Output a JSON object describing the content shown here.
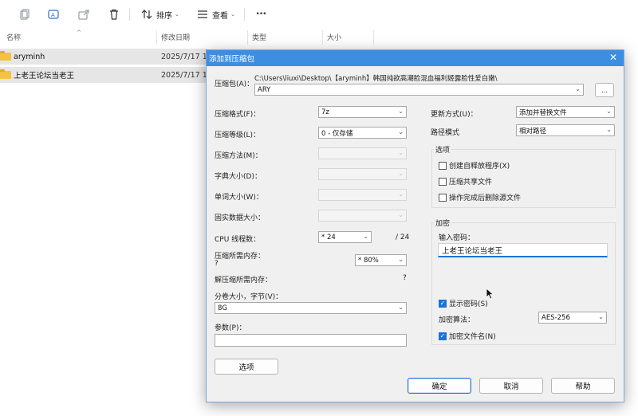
{
  "toolbar": {
    "sort_label": "排序",
    "view_label": "查看",
    "more_label": "•••"
  },
  "columns": {
    "name": "名称",
    "date": "修改日期",
    "type": "类型",
    "size": "大小"
  },
  "files": [
    {
      "name": "aryminh",
      "date": "2025/7/17 1"
    },
    {
      "name": "上老王论坛当老王",
      "date": "2025/7/17 1"
    }
  ],
  "dialog": {
    "title": "添加到压缩包",
    "close": "✕",
    "archive_label": "压缩包(A)：",
    "archive_path": "C:\\Users\\liuxi\\Desktop\\【aryminh】韩国纯欲高潮脸混血福利姬露脸性爱白嫩\\",
    "archive_name": "ARY",
    "browse": "...",
    "format_label": "压缩格式(F)：",
    "format_value": "7z",
    "level_label": "压缩等级(L)：",
    "level_value": "0 - 仅存储",
    "method_label": "压缩方法(M)：",
    "dict_label": "字典大小(D)：",
    "word_label": "单词大小(W)：",
    "solid_label": "固实数据大小：",
    "cpu_label": "CPU 线程数：",
    "cpu_value": "* 24",
    "cpu_total": "/ 24",
    "mem_comp_label": "压缩所需内存：",
    "mem_comp_q": "?",
    "mem_comp_value": "* 80%",
    "mem_decomp_label": "解压缩所需内存：",
    "mem_decomp_value": "?",
    "split_label": "分卷大小，字节(V)：",
    "split_value": "8G",
    "params_label": "参数(P)：",
    "params_value": "",
    "options_btn": "选项",
    "update_label": "更新方式(U)：",
    "update_value": "添加并替换文件",
    "path_label": "路径模式",
    "path_value": "相对路径",
    "options_group": "选项",
    "opt_sfx": "创建自释放程序(X)",
    "opt_shared": "压缩共享文件",
    "opt_delete": "操作完成后删除源文件",
    "enc_group": "加密",
    "pwd_label": "输入密码：",
    "pwd_value": "上老王论坛当老王",
    "show_pwd": "显示密码(S)",
    "enc_method_label": "加密算法：",
    "enc_method_value": "AES-256",
    "enc_names": "加密文件名(N)",
    "ok": "确定",
    "cancel": "取消",
    "help": "帮助"
  }
}
